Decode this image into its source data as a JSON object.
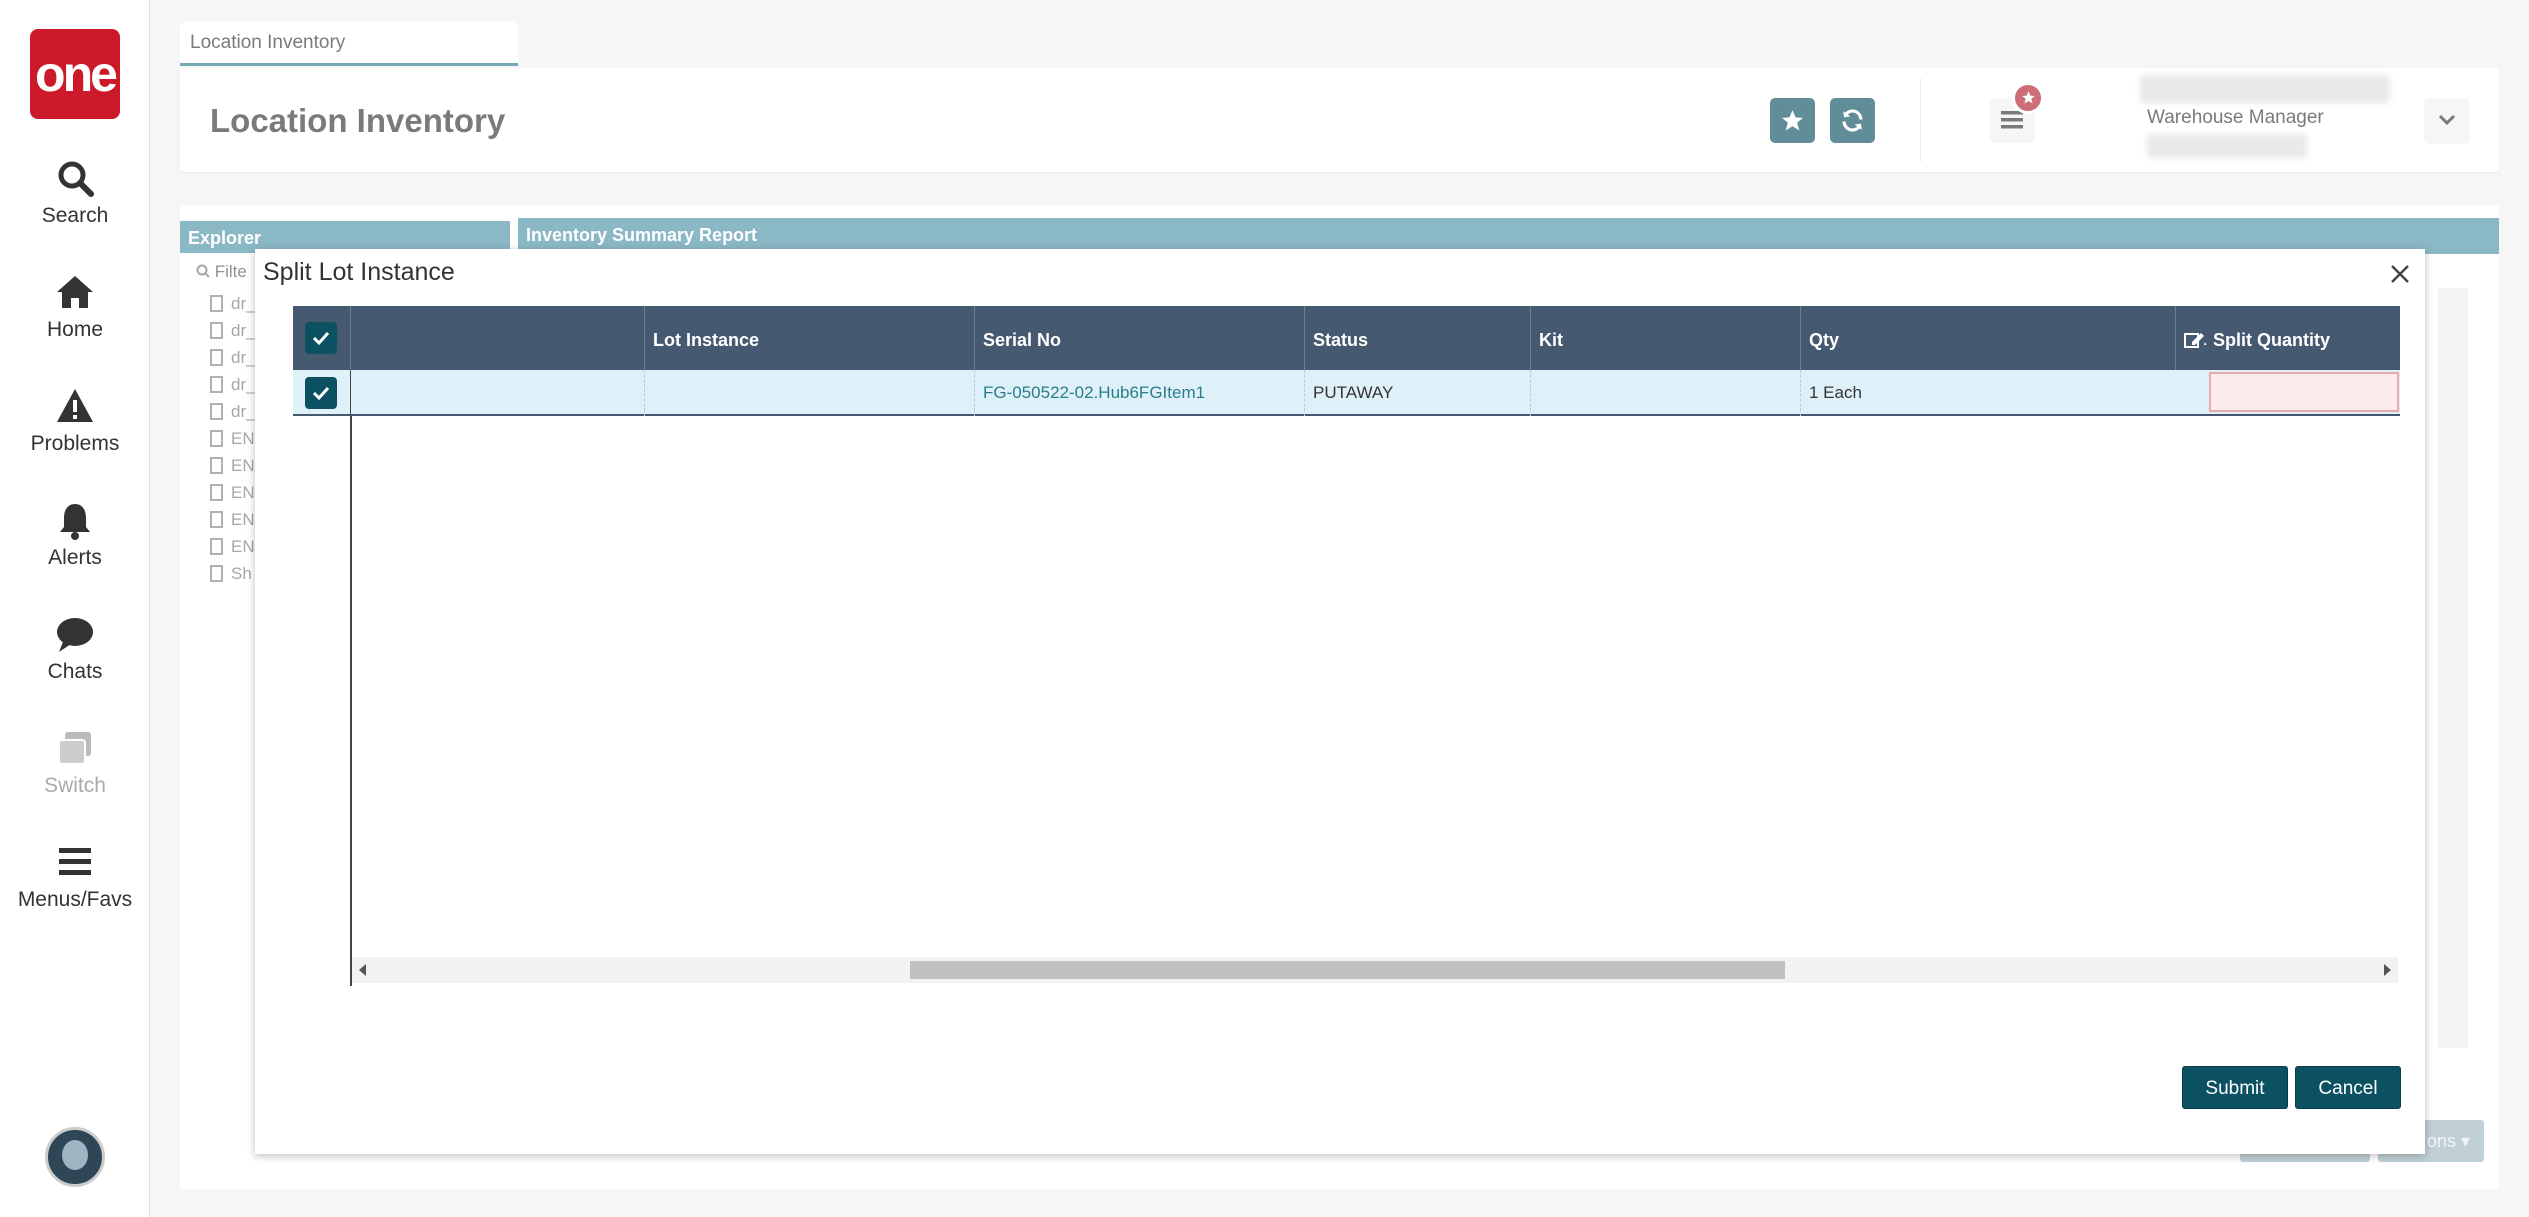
{
  "nav": {
    "logo": "one",
    "items": [
      {
        "label": "Search",
        "icon": "search-icon"
      },
      {
        "label": "Home",
        "icon": "home-icon"
      },
      {
        "label": "Problems",
        "icon": "warning-icon"
      },
      {
        "label": "Alerts",
        "icon": "bell-icon"
      },
      {
        "label": "Chats",
        "icon": "chat-icon"
      },
      {
        "label": "Switch",
        "icon": "switch-icon",
        "disabled": true
      },
      {
        "label": "Menus/Favs",
        "icon": "menu-icon"
      }
    ]
  },
  "tab": {
    "label": "Location Inventory"
  },
  "header": {
    "title": "Location Inventory",
    "role": "Warehouse Manager"
  },
  "background": {
    "explorer_title": "Explorer",
    "filter_placeholder": "Filte",
    "tree_items": [
      "dr_",
      "dr_",
      "dr_",
      "dr_",
      "dr_",
      "EN",
      "EN",
      "EN",
      "EN",
      "EN",
      "Sh"
    ],
    "report_title": "Inventory Summary Report",
    "actions_label": "ons"
  },
  "modal": {
    "title": "Split Lot Instance",
    "columns": [
      "",
      "Lot Instance",
      "Serial No",
      "Status",
      "Kit",
      "Qty",
      "Split Quantity"
    ],
    "rows": [
      {
        "col0": "",
        "lot_instance": "",
        "serial_no": "FG-050522-02.Hub6FGItem1",
        "status": "PUTAWAY",
        "kit": "",
        "qty": "1 Each",
        "split_quantity": ""
      }
    ],
    "submit_label": "Submit",
    "cancel_label": "Cancel"
  },
  "colors": {
    "brand_red": "#cc1a2a",
    "primary_teal": "#0c5161",
    "header_slate": "#455a70",
    "panel_header": "#4e92a7",
    "row_selected": "#dff1f8"
  }
}
